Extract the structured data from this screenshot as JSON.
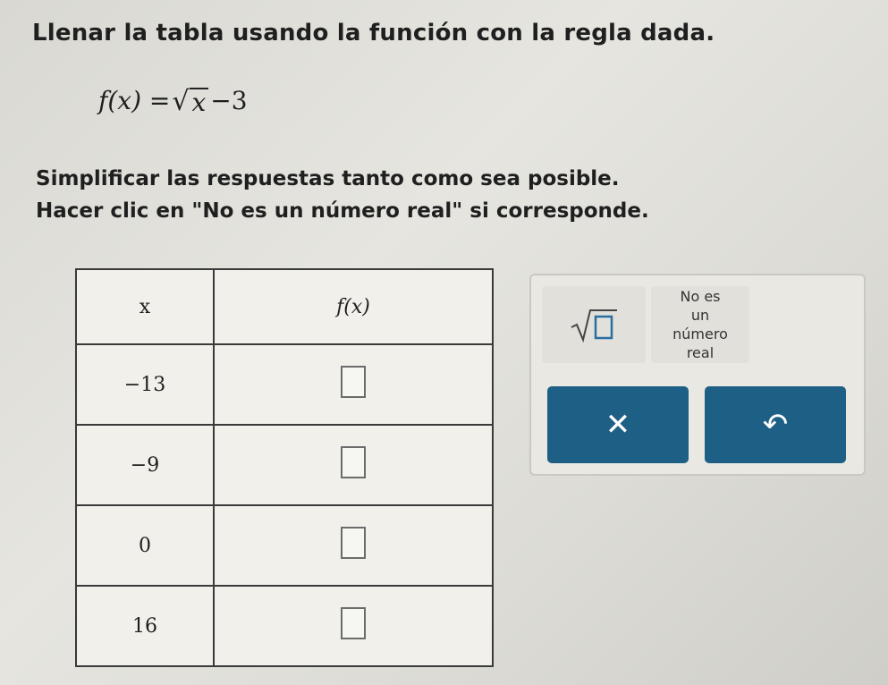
{
  "instructions": {
    "title": "Llenar la tabla usando la función con la regla dada.",
    "line1": "Simplificar las respuestas tanto como sea posible.",
    "line2": "Hacer clic en \"No es un número real\" si corresponde."
  },
  "formula": {
    "lhs": "f(x) = ",
    "radicand": "x",
    "rest": "−3"
  },
  "table": {
    "header_x": "x",
    "header_f": "f(x)",
    "rows": [
      {
        "x": "−13",
        "fx": ""
      },
      {
        "x": "−9",
        "fx": ""
      },
      {
        "x": "0",
        "fx": ""
      },
      {
        "x": "16",
        "fx": ""
      }
    ]
  },
  "toolbar": {
    "not_real_line1": "No es",
    "not_real_line2": "un",
    "not_real_line3": "número",
    "not_real_line4": "real",
    "clear_label": "✕",
    "undo_label": "↶"
  },
  "icons": {
    "sqrt_button": "sqrt-template-icon",
    "clear": "close-icon",
    "undo": "undo-icon"
  },
  "colors": {
    "action_button": "#1e5f86",
    "panel_bg": "#e9e8e3"
  }
}
